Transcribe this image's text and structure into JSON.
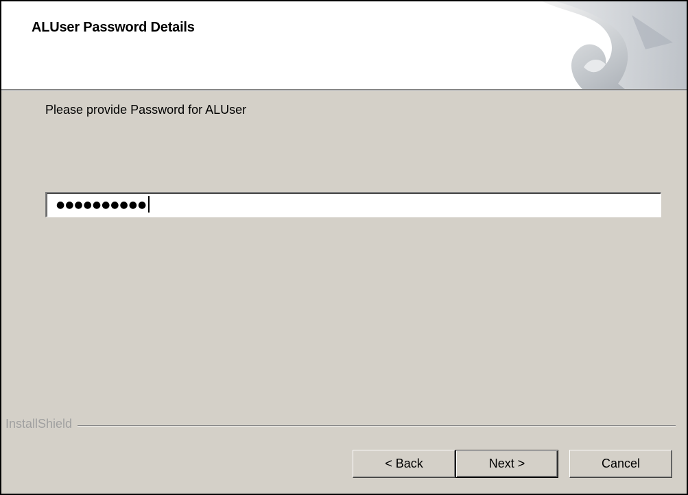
{
  "header": {
    "title": "ALUser Password Details",
    "graphic_icon": "installshield-swirl-graphic"
  },
  "main": {
    "prompt": "Please provide Password for ALUser",
    "password_field": {
      "masked_value": "●●●●●●●●●●",
      "has_caret": true
    }
  },
  "footer": {
    "brand_label": "InstallShield"
  },
  "buttons": {
    "back_label": "< Back",
    "next_label": "Next >",
    "cancel_label": "Cancel"
  },
  "colors": {
    "dialog_bg": "#d4d0c8",
    "header_bg": "#ffffff",
    "brand_text": "#a0a0a0"
  }
}
